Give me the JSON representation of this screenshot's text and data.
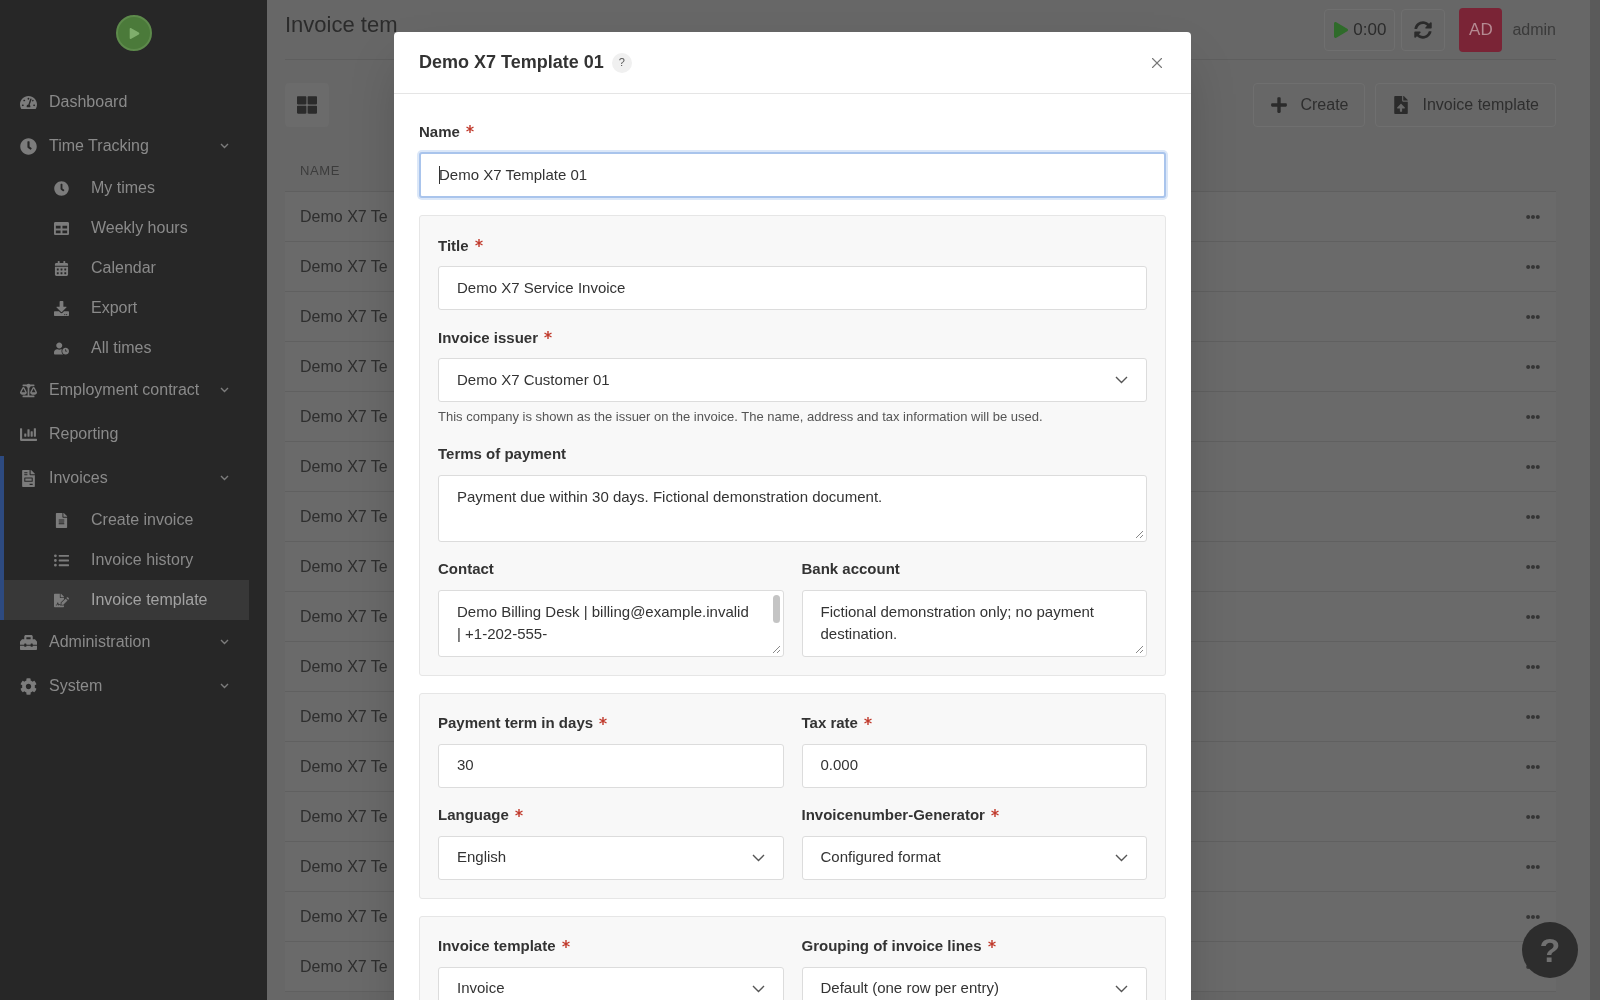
{
  "sidebar": {
    "items": [
      {
        "kind": "link",
        "label": "Dashboard",
        "selected": false
      },
      {
        "kind": "group",
        "label": "Time Tracking",
        "selected": false,
        "children": [
          {
            "label": "My times",
            "selected": false
          },
          {
            "label": "Weekly hours",
            "selected": false
          },
          {
            "label": "Calendar",
            "selected": false
          },
          {
            "label": "Export",
            "selected": false
          },
          {
            "label": "All times",
            "selected": false
          }
        ]
      },
      {
        "kind": "group",
        "label": "Employment contract",
        "selected": false
      },
      {
        "kind": "link",
        "label": "Reporting",
        "selected": false
      },
      {
        "kind": "group",
        "label": "Invoices",
        "selected": true,
        "children": [
          {
            "label": "Create invoice",
            "selected": false
          },
          {
            "label": "Invoice history",
            "selected": false
          },
          {
            "label": "Invoice template",
            "selected": true
          }
        ]
      },
      {
        "kind": "group",
        "label": "Administration",
        "selected": false
      },
      {
        "kind": "group",
        "label": "System",
        "selected": false
      }
    ]
  },
  "header": {
    "title": "Invoice tem",
    "timer": "0:00",
    "avatar": "AD",
    "user": "admin"
  },
  "toolbar": {
    "buttons": [
      "Create",
      "Invoice template"
    ]
  },
  "table": {
    "columns": [
      "NAME"
    ],
    "rows": [
      "Demo X7 Te",
      "Demo X7 Te",
      "Demo X7 Te",
      "Demo X7 Te",
      "Demo X7 Te",
      "Demo X7 Te",
      "Demo X7 Te",
      "Demo X7 Te",
      "Demo X7 Te",
      "Demo X7 Te",
      "Demo X7 Te",
      "Demo X7 Te",
      "Demo X7 Te",
      "Demo X7 Te",
      "Demo X7 Te",
      "Demo X7 Te"
    ]
  },
  "dialog": {
    "title": "Demo X7 Template 01",
    "help": "?",
    "name": {
      "label": "Name",
      "required": true,
      "value": "Demo X7 Template 01",
      "focused": true
    },
    "sections": [
      {
        "rows": [
          [
            {
              "kind": "text",
              "label": "Title",
              "required": true,
              "value": "Demo X7 Service Invoice"
            }
          ],
          [
            {
              "kind": "select",
              "label": "Invoice issuer",
              "required": true,
              "value": "Demo X7 Customer 01",
              "hint": "This company is shown as the issuer on the invoice. The name, address and tax information will be used."
            }
          ],
          [
            {
              "kind": "textarea",
              "label": "Terms of payment",
              "required": false,
              "value": "Payment due within 30 days. Fictional demonstration document."
            }
          ],
          [
            {
              "kind": "textarea",
              "label": "Contact",
              "required": false,
              "value": "Demo Billing Desk | billing@example.invalid | +1-202-555-",
              "scrollbar": true
            },
            {
              "kind": "textarea",
              "label": "Bank account",
              "required": false,
              "value": "Fictional demonstration only; no payment destination."
            }
          ]
        ]
      },
      {
        "rows": [
          [
            {
              "kind": "text",
              "label": "Payment term in days",
              "required": true,
              "value": "30"
            },
            {
              "kind": "text",
              "label": "Tax rate",
              "required": true,
              "value": "0.000"
            }
          ],
          [
            {
              "kind": "select",
              "label": "Language",
              "required": true,
              "value": "English"
            },
            {
              "kind": "select",
              "label": "Invoicenumber-Generator",
              "required": true,
              "value": "Configured format"
            }
          ]
        ]
      },
      {
        "rows": [
          [
            {
              "kind": "select",
              "label": "Invoice template",
              "required": true,
              "value": "Invoice"
            },
            {
              "kind": "select",
              "label": "Grouping of invoice lines",
              "required": true,
              "value": "Default (one row per entry)"
            }
          ]
        ]
      }
    ]
  },
  "help_button": "?"
}
